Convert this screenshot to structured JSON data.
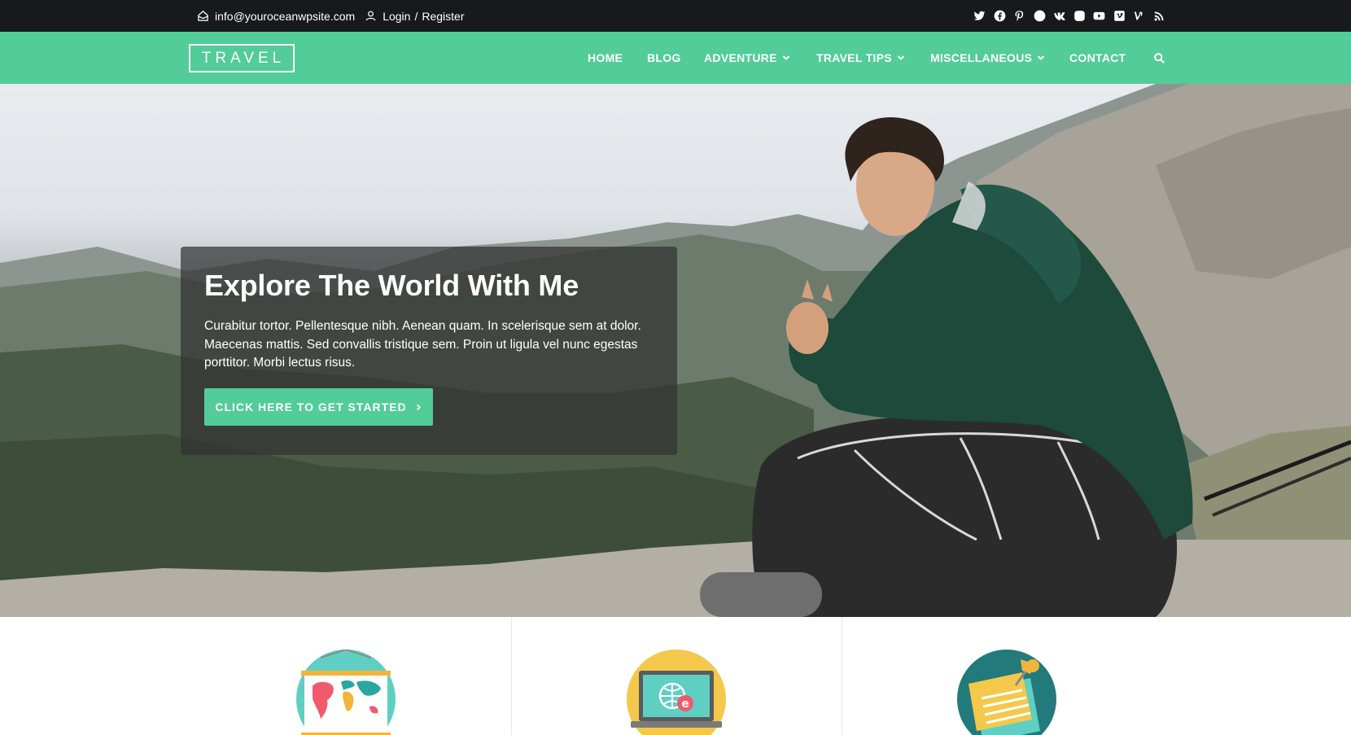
{
  "topbar": {
    "email": "info@youroceanwpsite.com",
    "login": "Login",
    "separator": "/",
    "register": "Register",
    "social_icons": [
      "twitter-icon",
      "facebook-icon",
      "pinterest-icon",
      "dribbble-icon",
      "vk-icon",
      "instagram-icon",
      "youtube-icon",
      "vimeo-square-icon",
      "vine-icon",
      "rss-icon"
    ]
  },
  "header": {
    "logo": "TRAVEL",
    "menu": [
      {
        "label": "HOME",
        "dropdown": false
      },
      {
        "label": "BLOG",
        "dropdown": false
      },
      {
        "label": "ADVENTURE",
        "dropdown": true
      },
      {
        "label": "TRAVEL TIPS",
        "dropdown": true
      },
      {
        "label": "MISCELLANEOUS",
        "dropdown": true
      },
      {
        "label": "CONTACT",
        "dropdown": false
      }
    ],
    "search_icon": "search-icon"
  },
  "hero": {
    "title": "Explore The World With Me",
    "text": "Curabitur tortor. Pellentesque nibh. Aenean quam. In scelerisque sem at dolor. Maecenas mattis. Sed convallis tristique sem. Proin ut ligula vel nunc egestas porttitor. Morbi lectus risus.",
    "button": "CLICK HERE TO GET STARTED"
  },
  "features": {
    "icons": [
      "world-map-icon",
      "laptop-globe-icon",
      "pinned-note-icon"
    ]
  },
  "colors": {
    "accent": "#52cc98",
    "topbar": "#17191c",
    "overlay": "#323232"
  }
}
